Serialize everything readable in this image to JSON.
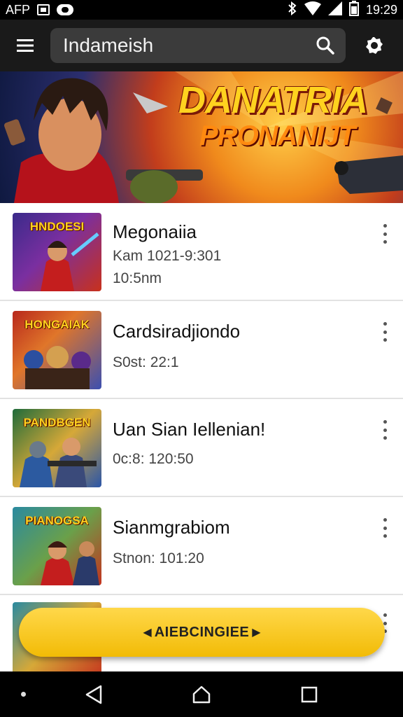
{
  "status_bar": {
    "carrier": "AFP",
    "time": "19:29",
    "icons": [
      "image-icon",
      "cloud-icon",
      "bluetooth-icon",
      "wifi-icon",
      "signal-icon",
      "battery-icon"
    ]
  },
  "app_bar": {
    "search_value": "Indameish",
    "icons": [
      "menu-icon",
      "search-icon",
      "settings-icon"
    ]
  },
  "banner": {
    "title": "DANATRIA",
    "subtitle": "PRONANIJT"
  },
  "list": {
    "items": [
      {
        "thumb_label": "HNDOESI",
        "title": "Megonaiia",
        "meta": [
          "Kam 1021-9:301",
          "10:5nm"
        ],
        "thumb_colors": [
          "#3a2a8a",
          "#c8311c"
        ]
      },
      {
        "thumb_label": "HONGAIAK",
        "title": "Cardsiradjiondo",
        "meta": [
          "S0st: 22:1"
        ],
        "thumb_colors": [
          "#b8281c",
          "#3b4fb0"
        ]
      },
      {
        "thumb_label": "PANDBGEN",
        "title": "Uan Sian Iellenian!",
        "meta": [
          "0c:8: 120:50"
        ],
        "thumb_colors": [
          "#1f6b3a",
          "#2a55a8"
        ]
      },
      {
        "thumb_label": "PIANOGSA",
        "title": "Sianmgrabiom",
        "meta": [
          "Stnon: 101:20"
        ],
        "thumb_colors": [
          "#2a8aa0",
          "#c4321e"
        ]
      }
    ]
  },
  "cta": {
    "label": "AIEBCINGIEE"
  },
  "nav_bar": {
    "icons": [
      "back-icon",
      "home-icon",
      "recents-icon"
    ]
  },
  "colors": {
    "app_bar": "#1a1a1a",
    "search_field": "#3b3b3b",
    "cta": "#f5c518",
    "divider": "#e2e2e2"
  }
}
